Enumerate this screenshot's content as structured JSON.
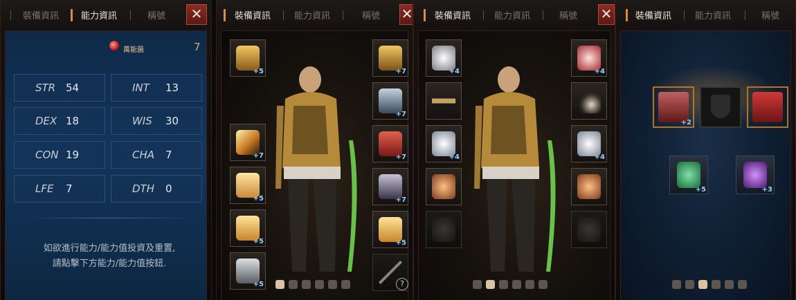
{
  "panels": {
    "stats": {
      "tabs": [
        "裝備資訊",
        "能力資訊",
        "稱號"
      ],
      "close": "✕",
      "resource": {
        "label": "萬能菌",
        "value": "7"
      },
      "stats": [
        {
          "key": "STR",
          "value": "54"
        },
        {
          "key": "INT",
          "value": "13"
        },
        {
          "key": "DEX",
          "value": "18"
        },
        {
          "key": "WIS",
          "value": "30"
        },
        {
          "key": "CON",
          "value": "19"
        },
        {
          "key": "CHA",
          "value": "7"
        },
        {
          "key": "LFE",
          "value": "7"
        },
        {
          "key": "DTH",
          "value": "0"
        }
      ],
      "hint_line1": "如欲進行能力/能力值投資及重置,",
      "hint_line2": "請點擊下方能力/能力值按鈕."
    },
    "gear1": {
      "tabs": [
        "裝備資訊",
        "能力資訊",
        "稱號"
      ],
      "close": "✕",
      "left_slots": [
        {
          "icon": "gold-helmet-icon",
          "plus": "+5",
          "color": "#d8a53a"
        },
        {
          "icon": "gold-sword-icon",
          "plus": "+7",
          "color": "#d98a2a"
        },
        {
          "icon": "gold-armor-icon",
          "plus": "+5",
          "color": "#e0b060"
        },
        {
          "icon": "gold-boots-icon",
          "plus": "+5",
          "color": "#e0a040"
        },
        {
          "icon": "silver-greaves-icon",
          "plus": "+5",
          "color": "#9a9ea4"
        }
      ],
      "right_slots": [
        {
          "icon": "gold-cloak-icon",
          "plus": "+7",
          "color": "#c99a3a"
        },
        {
          "icon": "gauntlet-icon",
          "plus": "+7",
          "color": "#8a9cb0"
        },
        {
          "icon": "red-cape-icon",
          "plus": "+7",
          "color": "#c03a30"
        },
        {
          "icon": "silver-shoulder-icon",
          "plus": "+7",
          "color": "#7a7088"
        },
        {
          "icon": "gold-glove-icon",
          "plus": "+5",
          "color": "#e0a040"
        },
        {
          "icon": "bow-icon",
          "plus": "",
          "color": "#3a3530"
        }
      ],
      "help": "?"
    },
    "gear2": {
      "tabs": [
        "裝備資訊",
        "能力資訊",
        "稱號"
      ],
      "close": "✕",
      "left_slots": [
        {
          "icon": "white-amulet-icon",
          "plus": "+4",
          "color": "#e6e6ea"
        },
        {
          "icon": "gold-belt-icon",
          "plus": "",
          "color": "#b08850"
        },
        {
          "icon": "silver-ring-icon",
          "plus": "+4",
          "color": "#c7cdd6"
        },
        {
          "icon": "gold-ring-icon",
          "plus": "",
          "color": "#d08a40"
        },
        {
          "icon": "empty-ring-slot-icon",
          "plus": "",
          "color": "#2a2624"
        }
      ],
      "right_slots": [
        {
          "icon": "red-amulet-icon",
          "plus": "+4",
          "color": "#e8c0c0"
        },
        {
          "icon": "skull-necklace-icon",
          "plus": "",
          "color": "#8a7a6a"
        },
        {
          "icon": "silver-ring-icon",
          "plus": "+4",
          "color": "#c7cdd6"
        },
        {
          "icon": "gold-ring-icon",
          "plus": "",
          "color": "#d08a40"
        },
        {
          "icon": "empty-ring-slot-icon",
          "plus": "",
          "color": "#2a2624"
        }
      ]
    },
    "titles": {
      "tabs": [
        "裝備資訊",
        "能力資訊",
        "稱號"
      ],
      "slots": [
        {
          "icon": "red-scroll-icon",
          "plus": "+2",
          "color": "#9a3030"
        },
        {
          "icon": "shield-icon",
          "plus": "",
          "color": "#2a2a2a"
        },
        {
          "icon": "lock-icon",
          "plus": "",
          "color": "#a02020"
        }
      ],
      "badges": [
        {
          "icon": "green-badge-icon",
          "plus": "+5",
          "color": "#2fa06a"
        },
        {
          "icon": "purple-badge-icon",
          "plus": "+3",
          "color": "#8a3ab0"
        }
      ]
    }
  },
  "colors": {
    "accent": "#e08a3a",
    "stats_bg": "#12365c",
    "close_red": "#8a2b22"
  }
}
